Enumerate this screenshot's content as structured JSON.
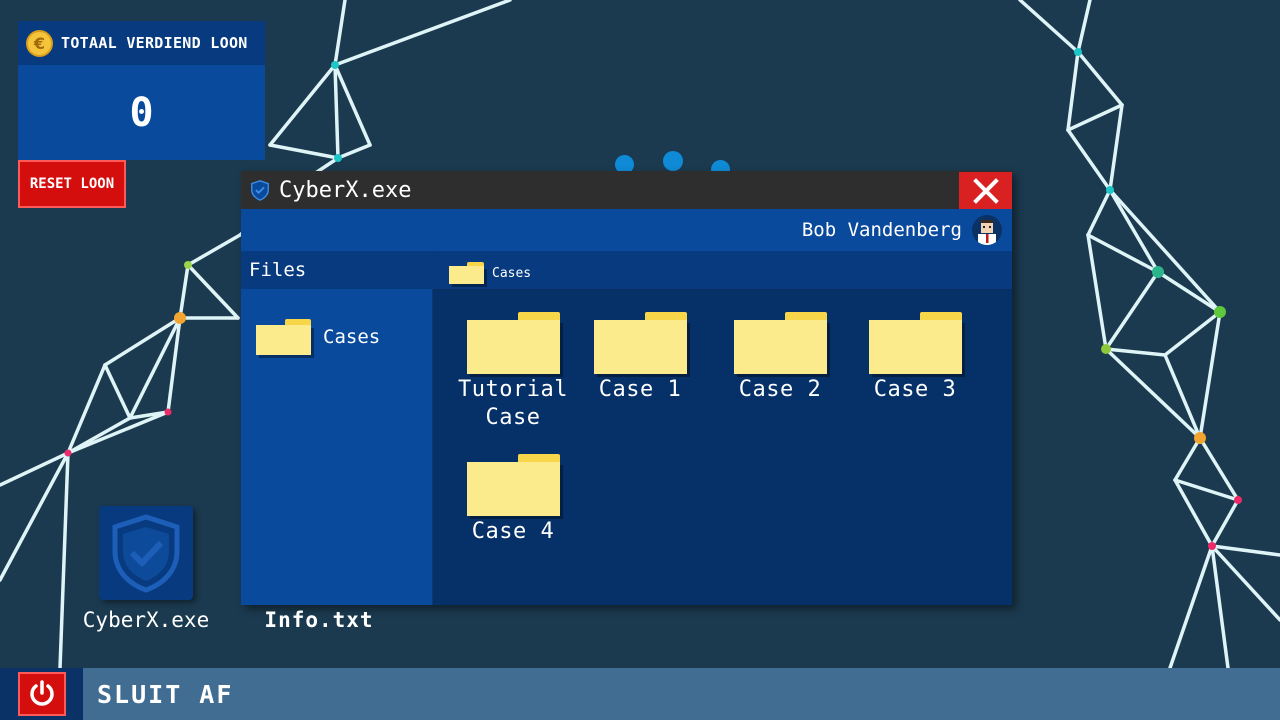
{
  "salary": {
    "label": "TOTAAL VERDIEND LOON",
    "value": "0",
    "reset_label": "RESET LOON"
  },
  "window": {
    "title": "CyberX.exe",
    "user_name": "Bob Vandenberg",
    "sidebar": {
      "header": "Files",
      "items": [
        {
          "label": "Cases"
        }
      ]
    },
    "breadcrumb": "Cases",
    "folders": [
      {
        "label": "Tutorial Case"
      },
      {
        "label": "Case 1"
      },
      {
        "label": "Case 2"
      },
      {
        "label": "Case 3"
      },
      {
        "label": "Case 4"
      }
    ]
  },
  "desktop": {
    "icons": [
      {
        "label": "CyberX.exe",
        "icon": "shield-check-icon"
      },
      {
        "label": "Info.txt",
        "icon": "text-file-icon"
      }
    ]
  },
  "taskbar": {
    "shutdown_label": "SLUIT AF"
  },
  "colors": {
    "background": "#1b3a4f",
    "window_blue": "#0a4a9c",
    "close_red": "#d92121",
    "folder_yellow": "#fbeb8c",
    "taskbar": "#426d92"
  }
}
